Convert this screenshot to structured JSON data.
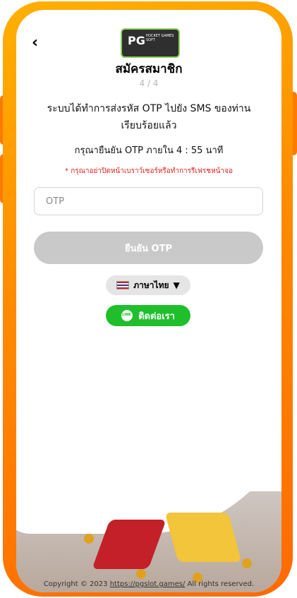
{
  "header": {
    "logo_text": "PG",
    "logo_subtext": "POCKET GAMES SOFT",
    "title": "สมัครสมาชิก",
    "step": "4 / 4"
  },
  "content": {
    "message": "ระบบได้ทำการส่งรหัส OTP ไปยัง SMS ของท่านเรียบร้อยแล้ว",
    "timer": "กรุณายืนยัน OTP ภายใน 4 : 55 นาที",
    "warning": "* กรุณาอย่าปิดหน้าเบราว์เซอร์หรือทำการรีเฟรชหน้าจอ"
  },
  "form": {
    "otp_placeholder": "OTP",
    "otp_value": "",
    "confirm_label": "ยืนยัน OTP"
  },
  "language": {
    "label": "ภาษาไทย",
    "caret": "▼",
    "flag_icon": "thailand-flag-icon"
  },
  "contact": {
    "label": "ติดต่อเรา",
    "icon": "line-icon",
    "icon_text": "LINE"
  },
  "footer": {
    "copyright": "Copyright © 2023",
    "link": "https://pgslot.games/",
    "suffix": "All rights reserved."
  },
  "colors": {
    "frame": "#ff8a00",
    "confirm_disabled": "#c9c9c9",
    "contact_green": "#1fbf2c",
    "warning_red": "#e11d1d"
  }
}
